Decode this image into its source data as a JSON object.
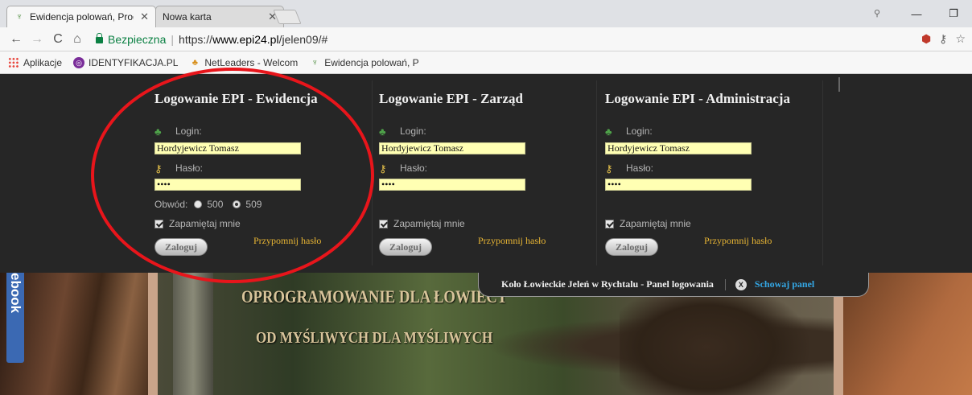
{
  "browser": {
    "tabs": [
      {
        "title": "Ewidencja polowań, Prog",
        "active": true,
        "favicon": "antler-icon"
      },
      {
        "title": "Nowa karta",
        "active": false
      }
    ],
    "window_controls": {
      "minimize": "—",
      "restore": "❐"
    },
    "nav": {
      "back": "←",
      "forward": "→",
      "reload": "C",
      "home": "⌂"
    },
    "secure_label": "Bezpieczna",
    "url_scheme": "https://",
    "url_host": "www.epi24.pl",
    "url_path": "/jelen09/#",
    "right_icons": [
      "extension-icon",
      "key-icon",
      "star-icon"
    ]
  },
  "bookmarks": [
    {
      "label": "Aplikacje",
      "icon": "apps-icon"
    },
    {
      "label": "IDENTYFIKACJA.PL",
      "icon": "id-icon"
    },
    {
      "label": "NetLeaders - Welcom",
      "icon": "netleaders-icon"
    },
    {
      "label": "Ewidencja polowań, P",
      "icon": "antler-icon"
    }
  ],
  "login_columns": [
    {
      "title": "Logowanie EPI - Ewidencja",
      "login_label": "Login:",
      "login_value": "Hordyjewicz Tomasz",
      "password_label": "Hasło:",
      "password_value": "••••",
      "district_label": "Obwód:",
      "districts": [
        {
          "value": "500",
          "checked": false
        },
        {
          "value": "509",
          "checked": true
        }
      ],
      "remember_label": "Zapamiętaj mnie",
      "login_button": "Zaloguj",
      "remind_link": "Przypomnij hasło"
    },
    {
      "title": "Logowanie EPI - Zarząd",
      "login_label": "Login:",
      "login_value": "Hordyjewicz Tomasz",
      "password_label": "Hasło:",
      "password_value": "••••",
      "remember_label": "Zapamiętaj mnie",
      "login_button": "Zaloguj",
      "remind_link": "Przypomnij hasło"
    },
    {
      "title": "Logowanie EPI - Administracja",
      "login_label": "Login:",
      "login_value": "Hordyjewicz Tomasz",
      "password_label": "Hasło:",
      "password_value": "••••",
      "remember_label": "Zapamiętaj mnie",
      "login_button": "Zaloguj",
      "remind_link": "Przypomnij hasło"
    }
  ],
  "panel_bar": {
    "title": "Koło Łowieckie Jeleń w Rychtalu - Panel logowania",
    "hide_label": "Schowaj panel",
    "close_icon_text": "X"
  },
  "hero": {
    "line1": "OPROGRAMOWANIE DLA ŁOWIECT",
    "line2": "OD MYŚLIWYCH DLA MYŚLIWYCH",
    "facebook_tab": "ebook"
  },
  "colors": {
    "panel_bg": "#262626",
    "input_bg": "#ffffb3",
    "link": "#e8b534",
    "hide_link": "#34a8e6",
    "annotation": "#e8151b",
    "secure": "#0b8043"
  }
}
